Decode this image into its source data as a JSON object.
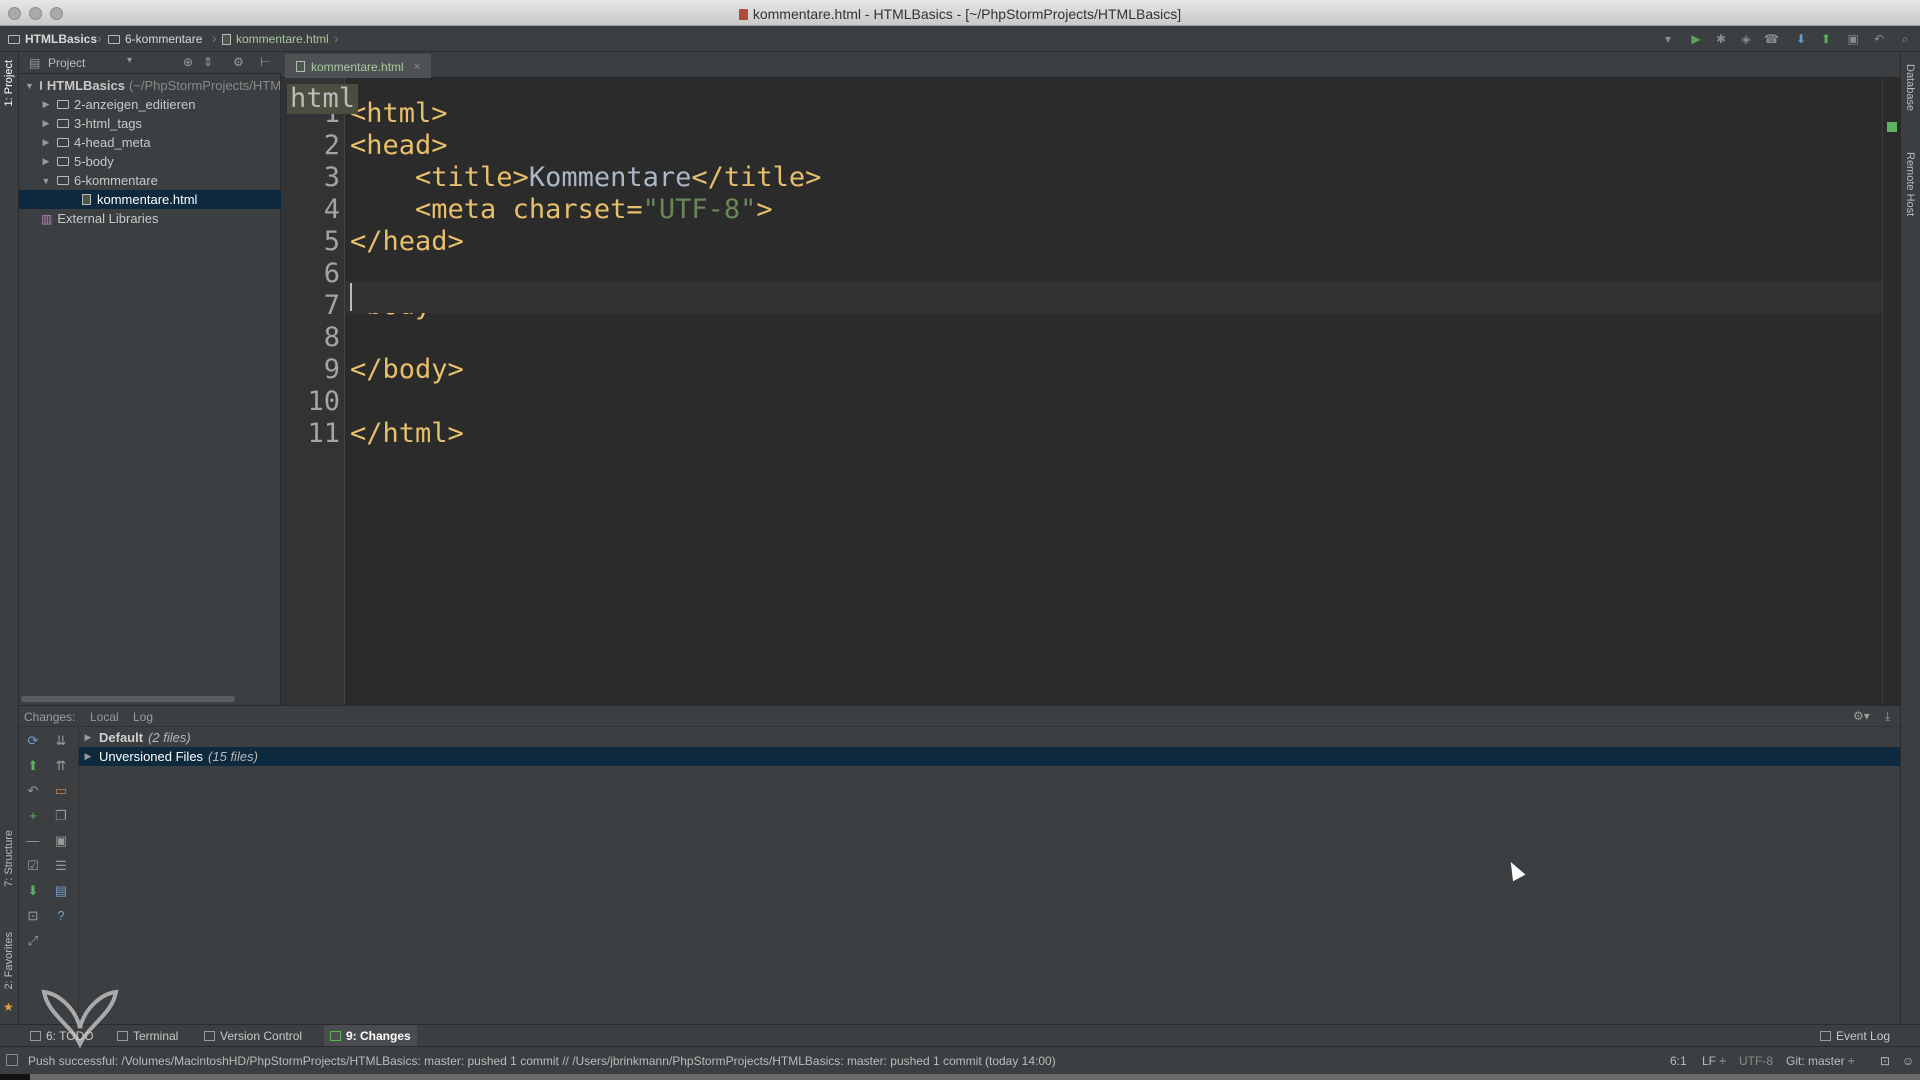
{
  "window": {
    "title": "kommentare.html - HTMLBasics - [~/PhpStormProjects/HTMLBasics]"
  },
  "navbar": {
    "crumbs": [
      "HTMLBasics",
      "6-kommentare",
      "kommentare.html"
    ]
  },
  "left_strip": {
    "project_tab": "1: Project",
    "structure_tab": "7: Structure",
    "favorites_tab": "2: Favorites"
  },
  "right_strip": {
    "database_tab": "Database",
    "remote_host_tab": "Remote Host"
  },
  "project_panel": {
    "view_selector": "Project",
    "tree": [
      {
        "label": "HTMLBasics",
        "suffix": "(~/PhpStormProjects/HTMLBasics)",
        "expanded": "yes"
      },
      {
        "label": "2-anzeigen_editieren"
      },
      {
        "label": "3-html_tags"
      },
      {
        "label": "4-head_meta"
      },
      {
        "label": "5-body"
      },
      {
        "label": "6-kommentare",
        "expanded": "yes"
      },
      {
        "label": "kommentare.html",
        "selected": "yes"
      },
      {
        "label": "External Libraries"
      }
    ]
  },
  "editor": {
    "tab_label": "kommentare.html",
    "scope_hint": "html",
    "lines": [
      {
        "num": "1",
        "parts": [
          [
            "tag",
            "<html>"
          ]
        ]
      },
      {
        "num": "2",
        "parts": [
          [
            "tag",
            "<head>"
          ]
        ]
      },
      {
        "num": "3",
        "parts": [
          [
            "tag",
            "    <title>"
          ],
          [
            "txt",
            "Kommentare"
          ],
          [
            "tag",
            "</title>"
          ]
        ]
      },
      {
        "num": "4",
        "parts": [
          [
            "tag",
            "    <meta "
          ],
          [
            "attr",
            "charset="
          ],
          [
            "str",
            "\"UTF-8\""
          ],
          [
            "tag",
            ">"
          ]
        ]
      },
      {
        "num": "5",
        "parts": [
          [
            "tag",
            "</head>"
          ]
        ]
      },
      {
        "num": "6",
        "parts": []
      },
      {
        "num": "7",
        "parts": [
          [
            "tag",
            "<body>"
          ]
        ]
      },
      {
        "num": "8",
        "parts": []
      },
      {
        "num": "9",
        "parts": [
          [
            "tag",
            "</body>"
          ]
        ]
      },
      {
        "num": "10",
        "parts": []
      },
      {
        "num": "11",
        "parts": [
          [
            "tag",
            "</html>"
          ]
        ]
      }
    ]
  },
  "changes_panel": {
    "header": [
      "Changes:",
      "Local",
      "Log"
    ],
    "groups": [
      {
        "name": "Default",
        "count": "(2 files)"
      },
      {
        "name": "Unversioned Files",
        "count": "(15 files)",
        "selected": "yes"
      }
    ]
  },
  "tool_windows": {
    "todo": "6: TODO",
    "terminal": "Terminal",
    "version_control": "Version Control",
    "changes": "9: Changes",
    "event_log": "Event Log"
  },
  "status_bar": {
    "message": "Push successful: /Volumes/MacintoshHD/PhpStormProjects/HTMLBasics: master: pushed 1 commit // /Users/jbrinkmann/PhpStormProjects/HTMLBasics: master: pushed 1 commit (today 14:00)",
    "position": "6:1",
    "line_sep": "LF ÷",
    "encoding": "UTF-8",
    "vcs": "Git: master ÷"
  },
  "colors": {
    "tag": "#e8bf6a",
    "string": "#6a8759",
    "text": "#a9b7c6",
    "selection": "#0d293e",
    "panel": "#3c3f41",
    "editor": "#2b2b2b"
  }
}
